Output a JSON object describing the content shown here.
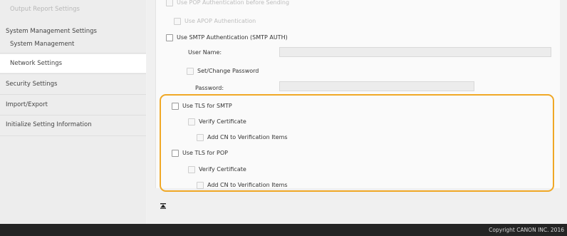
{
  "sidebar": {
    "items": [
      {
        "label": "Output Report Settings"
      },
      {
        "label": "System Management Settings"
      },
      {
        "label": "System Management"
      },
      {
        "label": "Network Settings"
      },
      {
        "label": "Security Settings"
      },
      {
        "label": "Import/Export"
      },
      {
        "label": "Initialize Setting Information"
      }
    ],
    "selected": "Network Settings"
  },
  "form": {
    "top_cut_label": "Use POP Authentication before Sending",
    "apop_label": "Use APOP Authentication",
    "smtp_auth_label": "Use SMTP Authentication (SMTP AUTH)",
    "user_name_label": "User Name:",
    "user_name_value": "",
    "set_change_password_label": "Set/Change Password",
    "password_label": "Password:",
    "password_value": "",
    "tls_smtp_label": "Use TLS for SMTP",
    "verify_cert_smtp_label": "Verify Certificate",
    "add_cn_smtp_label": "Add CN to Verification Items",
    "tls_pop_label": "Use TLS for POP",
    "verify_cert_pop_label": "Verify Certificate",
    "add_cn_pop_label": "Add CN to Verification Items"
  },
  "highlight_color": "#f0a826",
  "back_to_top_icon": "back-to-top-icon",
  "footer": {
    "copyright": "Copyright CANON INC. 2016"
  }
}
